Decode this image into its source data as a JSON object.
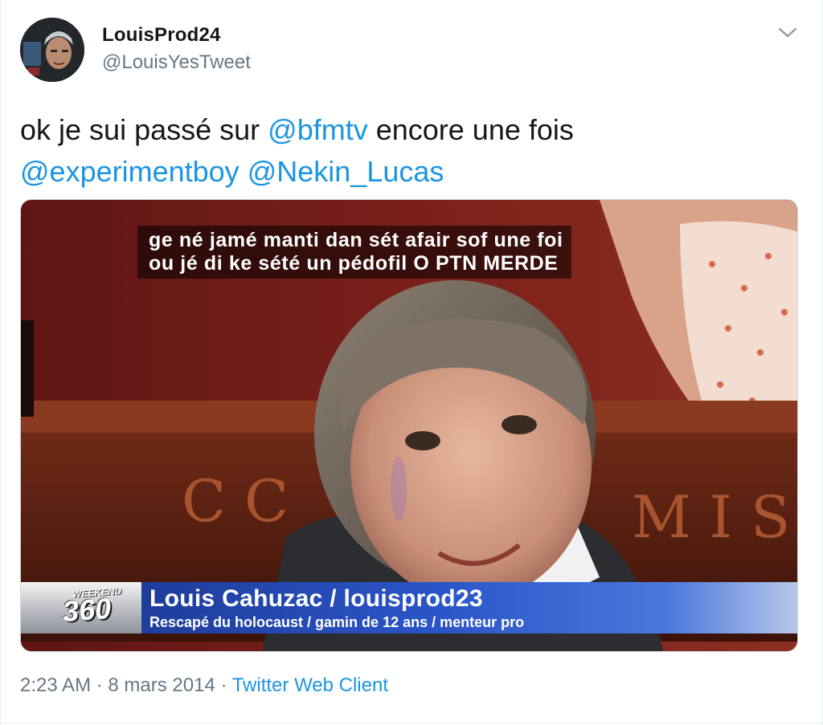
{
  "tweet": {
    "display_name": "LouisProd24",
    "handle": "@LouisYesTweet",
    "text_line1_prefix": "ok je sui passé sur ",
    "mention_bfmtv": "@bfmtv",
    "text_line1_suffix": " encore une fois",
    "mention_experimentboy": "@experimentboy",
    "mention_nekin": "@Nekin_Lucas",
    "time": "2:23 AM",
    "date": "8 mars 2014",
    "separator": "·",
    "client": "Twitter Web Client"
  },
  "media": {
    "subtitle_line1": "ge né jamé manti dan sét afair sof une foi",
    "subtitle_line2": "ou jé di ke sété un pédofil O PTN MERDE",
    "banner_weekend": "WEEKEND",
    "banner_360": "360",
    "banner_title": "Louis Cahuzac / louisprod23",
    "banner_subtitle": "Rescapé du holocaust / gamin de 12 ans / menteur pro",
    "wall_letters_left": "C C",
    "wall_letters_right": "M I S"
  },
  "icons": {
    "avatar": "avatar",
    "caret": "chevron-down-icon"
  },
  "colors": {
    "link": "#1b95e0",
    "text": "#14171a",
    "muted": "#657786"
  }
}
